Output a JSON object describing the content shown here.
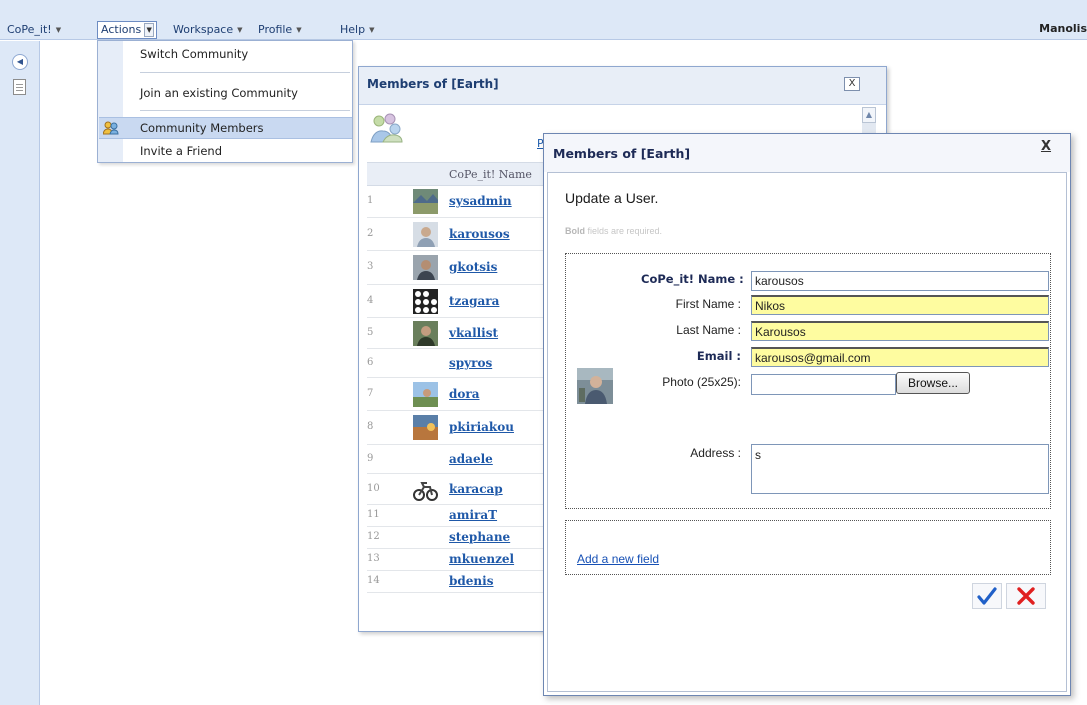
{
  "menubar": {
    "items": [
      {
        "label": "CoPe_it!"
      },
      {
        "label": "Actions"
      },
      {
        "label": "Workspace"
      },
      {
        "label": "Profile"
      },
      {
        "label": "Help"
      }
    ],
    "username": "Manolis"
  },
  "actions_menu": {
    "items": [
      {
        "label": "Switch Community"
      },
      {
        "label": "Join an existing Community"
      },
      {
        "label": "Community Members"
      },
      {
        "label": "Invite a Friend"
      }
    ]
  },
  "members_window": {
    "title": "Members of [Earth]",
    "close_label": "X",
    "link_stub": "Pe",
    "column_header": "CoPe_it! Name",
    "members": [
      {
        "num": "1",
        "name": "sysadmin",
        "avatar": "landscape"
      },
      {
        "num": "2",
        "name": "karousos",
        "avatar": "person-light"
      },
      {
        "num": "3",
        "name": "gkotsis",
        "avatar": "person-dark"
      },
      {
        "num": "4",
        "name": "tzagara",
        "avatar": "dots-pattern"
      },
      {
        "num": "5",
        "name": "vkallist",
        "avatar": "person-green"
      },
      {
        "num": "6",
        "name": "spyros",
        "avatar": ""
      },
      {
        "num": "7",
        "name": "dora",
        "avatar": "outdoor-scene"
      },
      {
        "num": "8",
        "name": "pkiriakou",
        "avatar": "sunset-scene"
      },
      {
        "num": "9",
        "name": "adaele",
        "avatar": ""
      },
      {
        "num": "10",
        "name": "karacap",
        "avatar": "motorbike"
      },
      {
        "num": "11",
        "name": "amiraT",
        "avatar": ""
      },
      {
        "num": "12",
        "name": "stephane",
        "avatar": ""
      },
      {
        "num": "13",
        "name": "mkuenzel",
        "avatar": ""
      },
      {
        "num": "14",
        "name": "bdenis",
        "avatar": ""
      }
    ]
  },
  "edit_window": {
    "title": "Members of [Earth]",
    "close_label": "X",
    "heading": "Update a User.",
    "hint_bold": "Bold",
    "hint_rest": " fields are required.",
    "fields": {
      "cope_name": {
        "label": "CoPe_it! Name :",
        "value": "karousos"
      },
      "first_name": {
        "label": "First Name :",
        "value": "Nikos"
      },
      "last_name": {
        "label": "Last Name :",
        "value": "Karousos"
      },
      "email": {
        "label": "Email :",
        "value": "karousos@gmail.com"
      },
      "photo": {
        "label": "Photo (25x25):",
        "value": "",
        "browse_label": "Browse..."
      },
      "address": {
        "label": "Address :",
        "value": "s"
      }
    },
    "add_field_label": "Add a new field",
    "colors": {
      "required_label": "#1d2a56",
      "highlight": "#fefca0",
      "ok": "#2060c8",
      "cancel": "#e02020"
    }
  }
}
